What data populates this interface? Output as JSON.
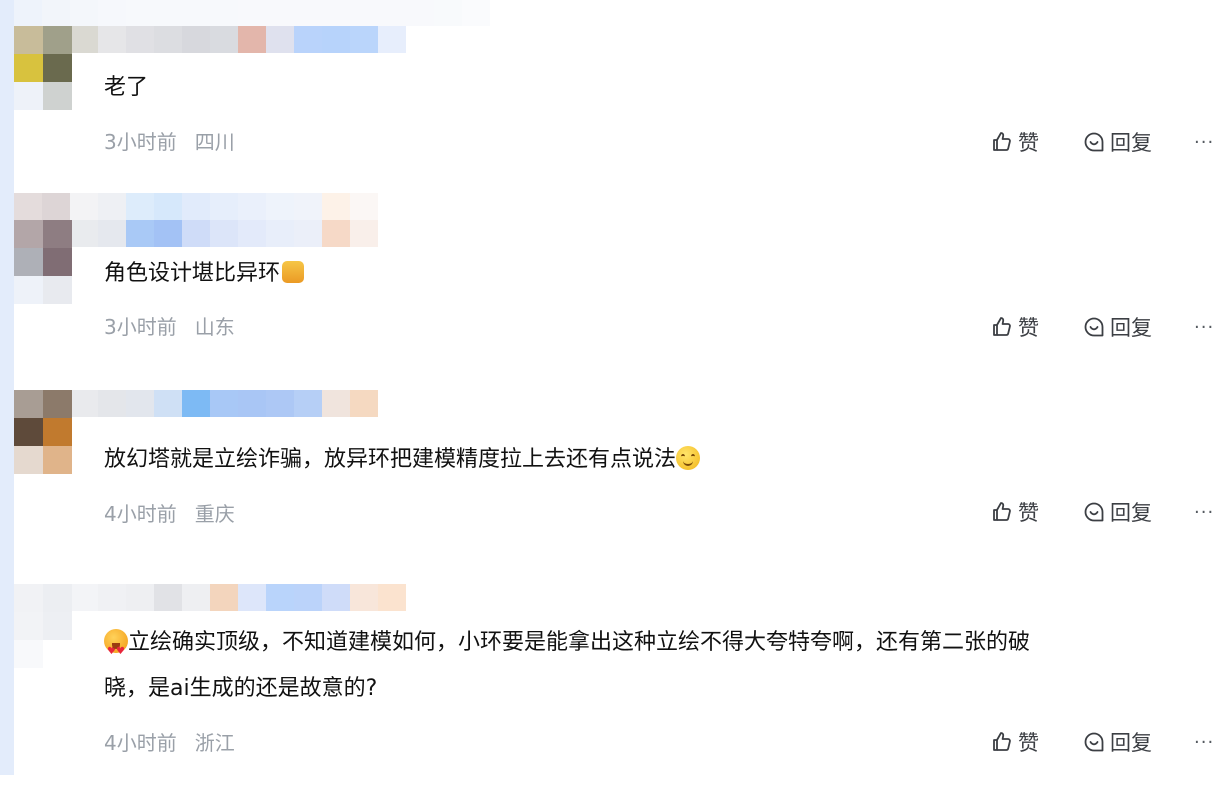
{
  "comments": [
    {
      "text": "老了",
      "time": "3小时前",
      "location": "四川",
      "like_label": "赞",
      "reply_label": "回复",
      "more_label": "···"
    },
    {
      "text": "角色设计堪比异环",
      "emoji": "thumbs-up-emoji",
      "time": "3小时前",
      "location": "山东",
      "like_label": "赞",
      "reply_label": "回复",
      "more_label": "···"
    },
    {
      "text": "放幻塔就是立绘诈骗，放异环把建模精度拉上去还有点说法",
      "emoji": "smiling-face-emoji",
      "time": "4小时前",
      "location": "重庆",
      "like_label": "赞",
      "reply_label": "回复",
      "more_label": "···"
    },
    {
      "emoji_lead": "heart-eyes-emoji",
      "text_line1": "立绘确实顶级，不知道建模如何，小环要是能拿出这种立绘不得大夸特夸啊，还有第二张的破",
      "text_line2": "晓，是ai生成的还是故意的?",
      "time": "4小时前",
      "location": "浙江",
      "like_label": "赞",
      "reply_label": "回复",
      "more_label": "···"
    }
  ],
  "colors": {
    "text": "#111111",
    "meta": "#9aa0a8",
    "action": "#3c3f44",
    "blur_blue": "#9cc4f7",
    "left_strip": "#e3ecfb"
  }
}
